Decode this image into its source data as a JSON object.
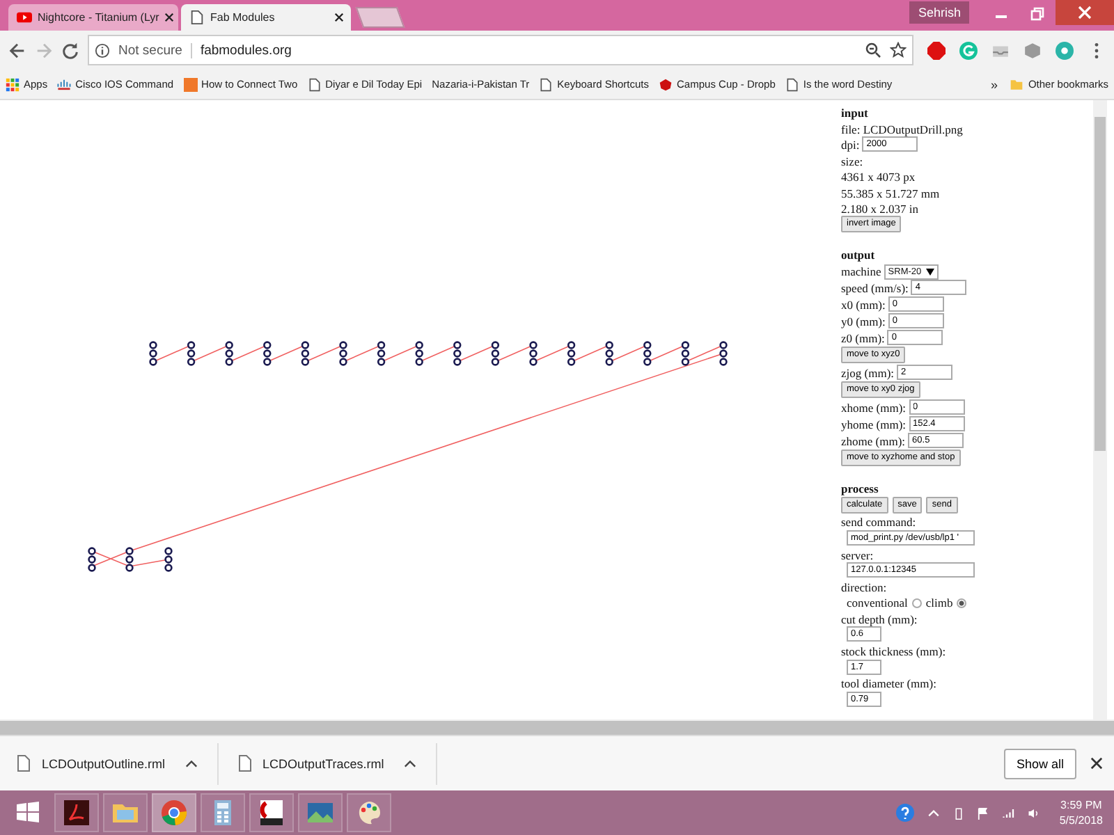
{
  "browser_tabs": [
    {
      "title": "Nightcore - Titanium (Lyr",
      "kind": "video",
      "selected": false
    },
    {
      "title": "Fab Modules",
      "kind": "page",
      "selected": true
    }
  ],
  "user": "Sehrish",
  "address_bar": {
    "security": "Not secure",
    "url": "fabmodules.org"
  },
  "bookmarks": [
    {
      "label": "Apps",
      "kind": "apps"
    },
    {
      "label": "Cisco IOS Command",
      "kind": "cisco"
    },
    {
      "label": "How to Connect Two",
      "kind": "badge"
    },
    {
      "label": "Diyar e Dil Today Epi",
      "kind": "page"
    },
    {
      "label": "Nazaria-i-Pakistan Tr",
      "kind": "none"
    },
    {
      "label": "Keyboard Shortcuts",
      "kind": "page"
    },
    {
      "label": "Campus Cup - Dropb",
      "kind": "red"
    },
    {
      "label": "Is the word Destiny",
      "kind": "page"
    }
  ],
  "bookmarks_more": "»",
  "other_bookmarks": "Other bookmarks",
  "sections": [
    {
      "title": "input",
      "rows": [
        {
          "kind": "text",
          "text": "file: LCDOutputDrill.png"
        },
        {
          "kind": "field",
          "label": "dpi:",
          "value": "2000"
        },
        {
          "kind": "text",
          "text": "size:"
        },
        {
          "kind": "text",
          "text": "4361 x 4073 px"
        },
        {
          "kind": "text",
          "text": "55.385 x 51.727 mm"
        },
        {
          "kind": "text",
          "text": "2.180 x 2.037 in"
        },
        {
          "kind": "buttons",
          "buttons": [
            "invert image"
          ]
        }
      ]
    },
    {
      "title": "output",
      "rows": [
        {
          "kind": "select",
          "label": "machine",
          "value": "SRM-20"
        },
        {
          "kind": "field",
          "label": "speed (mm/s):",
          "value": "4"
        },
        {
          "kind": "field",
          "label": "x0 (mm):",
          "value": "0"
        },
        {
          "kind": "field",
          "label": "y0 (mm):",
          "value": "0"
        },
        {
          "kind": "field",
          "label": "z0 (mm):",
          "value": "0"
        },
        {
          "kind": "buttons",
          "buttons": [
            "move to xyz0"
          ]
        },
        {
          "kind": "field",
          "label": "zjog (mm):",
          "value": "2"
        },
        {
          "kind": "buttons",
          "buttons": [
            "move to xy0 zjog"
          ]
        },
        {
          "kind": "field",
          "label": "xhome (mm):",
          "value": "0"
        },
        {
          "kind": "field",
          "label": "yhome (mm):",
          "value": "152.4"
        },
        {
          "kind": "field",
          "label": "zhome (mm):",
          "value": "60.5"
        },
        {
          "kind": "buttons",
          "buttons": [
            "move to xyzhome and stop"
          ]
        }
      ]
    },
    {
      "title": "process",
      "rows": [
        {
          "kind": "buttons",
          "buttons": [
            "calculate",
            "save",
            "send"
          ]
        },
        {
          "kind": "text",
          "text": "send command:"
        },
        {
          "kind": "wide",
          "value": "mod_print.py /dev/usb/lp1 '"
        },
        {
          "kind": "text",
          "text": "server:"
        },
        {
          "kind": "wide",
          "value": "127.0.0.1:12345"
        },
        {
          "kind": "text",
          "text": "direction:"
        },
        {
          "kind": "radio",
          "options": [
            {
              "label": "conventional",
              "selected": false
            },
            {
              "label": "climb",
              "selected": true
            }
          ]
        },
        {
          "kind": "text",
          "text": "cut depth (mm):"
        },
        {
          "kind": "short",
          "value": "0.6"
        },
        {
          "kind": "text",
          "text": "stock thickness (mm):"
        },
        {
          "kind": "short",
          "value": "1.7"
        },
        {
          "kind": "text",
          "text": "tool diameter (mm):"
        },
        {
          "kind": "short",
          "value": "0.79"
        }
      ]
    }
  ],
  "downloads": [
    {
      "name": "LCDOutputOutline.rml"
    },
    {
      "name": "LCDOutputTraces.rml"
    }
  ],
  "show_all": "Show all",
  "taskbar": [
    {
      "kind": "windows"
    },
    {
      "kind": "pdf"
    },
    {
      "kind": "folder"
    },
    {
      "kind": "chrome",
      "selected": true
    },
    {
      "kind": "calculator"
    },
    {
      "kind": "eagle"
    },
    {
      "kind": "photo"
    },
    {
      "kind": "paint"
    }
  ],
  "clock": {
    "time": "3:59 PM",
    "date": "5/5/2018"
  }
}
